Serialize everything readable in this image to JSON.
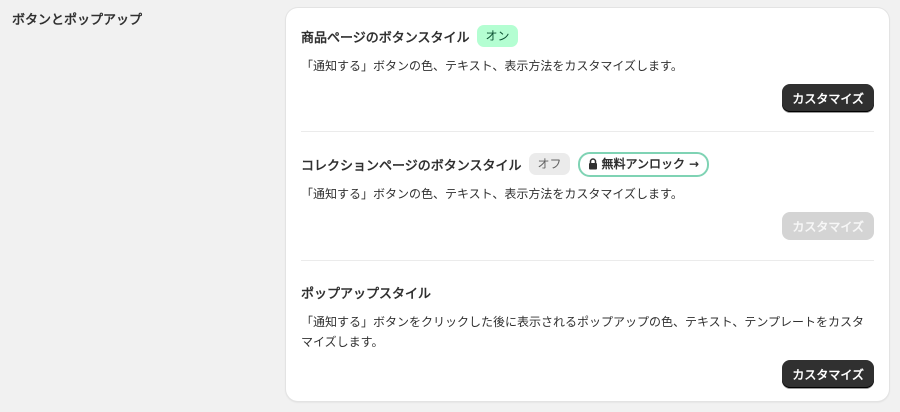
{
  "section": {
    "title": "ボタンとポップアップ"
  },
  "items": [
    {
      "title": "商品ページのボタンスタイル",
      "status": "オン",
      "description": "「通知する」ボタンの色、テキスト、表示方法をカスタマイズします。",
      "button_label": "カスタマイズ",
      "button_enabled": true
    },
    {
      "title": "コレクションページのボタンスタイル",
      "status": "オフ",
      "unlock_label": "無料アンロック",
      "unlock_arrow": "→",
      "description": "「通知する」ボタンの色、テキスト、表示方法をカスタマイズします。",
      "button_label": "カスタマイズ",
      "button_enabled": false
    },
    {
      "title": "ポップアップスタイル",
      "description": "「通知する」ボタンをクリックした後に表示されるポップアップの色、テキスト、テンプレートをカスタマイズします。",
      "button_label": "カスタマイズ",
      "button_enabled": true
    }
  ],
  "colors": {
    "on_badge_bg": "#b4fed2",
    "off_badge_bg": "#ebebeb",
    "unlock_border": "#7fd3b4",
    "primary_button": "#303030",
    "disabled_button": "#d4d4d4"
  },
  "icons": {
    "unlock": "lock-icon"
  }
}
